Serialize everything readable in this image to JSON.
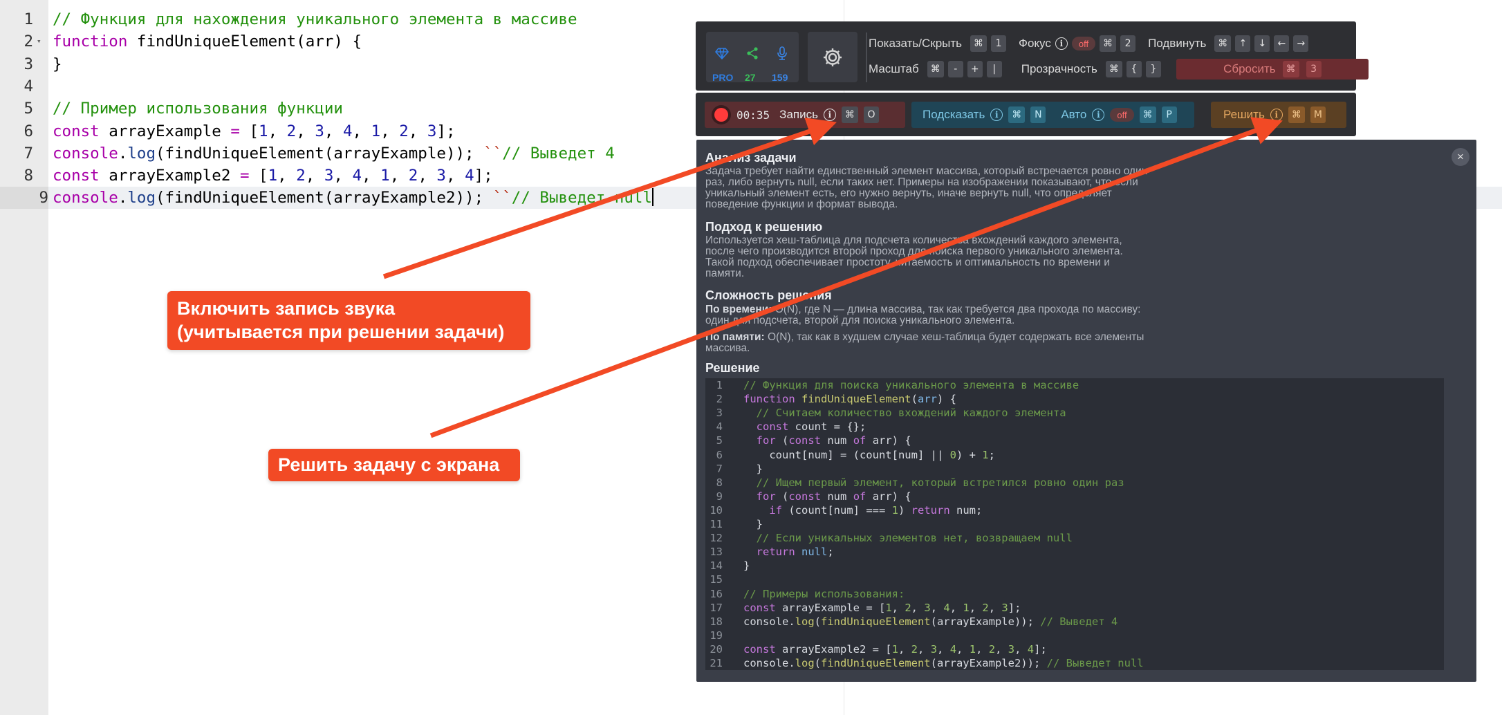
{
  "editor": {
    "lines": [
      {
        "n": "1",
        "tokens": [
          [
            "c",
            "// Функция для нахождения уникального элемента в массиве"
          ]
        ]
      },
      {
        "n": "2",
        "fold": true,
        "tokens": [
          [
            "k",
            "function"
          ],
          [
            "p",
            " findUniqueElement(arr) {"
          ]
        ]
      },
      {
        "n": "3",
        "tokens": [
          [
            "p",
            "}"
          ]
        ]
      },
      {
        "n": "4",
        "tokens": []
      },
      {
        "n": "5",
        "tokens": [
          [
            "c",
            "// Пример использования функции"
          ]
        ]
      },
      {
        "n": "6",
        "tokens": [
          [
            "k",
            "const"
          ],
          [
            "p",
            " arrayExample "
          ],
          [
            "k",
            "="
          ],
          [
            "p",
            " ["
          ],
          [
            "n",
            "1"
          ],
          [
            "p",
            ", "
          ],
          [
            "n",
            "2"
          ],
          [
            "p",
            ", "
          ],
          [
            "n",
            "3"
          ],
          [
            "p",
            ", "
          ],
          [
            "n",
            "4"
          ],
          [
            "p",
            ", "
          ],
          [
            "n",
            "1"
          ],
          [
            "p",
            ", "
          ],
          [
            "n",
            "2"
          ],
          [
            "p",
            ", "
          ],
          [
            "n",
            "3"
          ],
          [
            "p",
            "];"
          ]
        ]
      },
      {
        "n": "7",
        "tokens": [
          [
            "k",
            "console"
          ],
          [
            "p",
            "."
          ],
          [
            "f",
            "log"
          ],
          [
            "p",
            "(findUniqueElement(arrayExample)); "
          ],
          [
            "s",
            "``"
          ],
          [
            "c",
            "// Выведет 4"
          ]
        ]
      },
      {
        "n": "8",
        "tokens": [
          [
            "k",
            "const"
          ],
          [
            "p",
            " arrayExample2 "
          ],
          [
            "k",
            "="
          ],
          [
            "p",
            " ["
          ],
          [
            "n",
            "1"
          ],
          [
            "p",
            ", "
          ],
          [
            "n",
            "2"
          ],
          [
            "p",
            ", "
          ],
          [
            "n",
            "3"
          ],
          [
            "p",
            ", "
          ],
          [
            "n",
            "4"
          ],
          [
            "p",
            ", "
          ],
          [
            "n",
            "1"
          ],
          [
            "p",
            ", "
          ],
          [
            "n",
            "2"
          ],
          [
            "p",
            ", "
          ],
          [
            "n",
            "3"
          ],
          [
            "p",
            ", "
          ],
          [
            "n",
            "4"
          ],
          [
            "p",
            "];"
          ]
        ]
      },
      {
        "n": "9",
        "active": true,
        "tokens": [
          [
            "k",
            "console"
          ],
          [
            "p",
            "."
          ],
          [
            "f",
            "log"
          ],
          [
            "p",
            "(findUniqueElement(arrayExample2)); "
          ],
          [
            "s",
            "``"
          ],
          [
            "c",
            "// Выведет null"
          ]
        ]
      }
    ]
  },
  "toolbar": {
    "status": {
      "pro": "PRO",
      "shares": "27",
      "mic_count": "159"
    },
    "show_hide_label": "Показать/Скрыть",
    "show_hide_keys": [
      "⌘",
      "1"
    ],
    "focus_label": "Фокус",
    "focus_state": "off",
    "focus_keys": [
      "⌘",
      "2"
    ],
    "move_label": "Подвинуть",
    "move_keys": [
      "⌘",
      "↑",
      "↓",
      "←",
      "→"
    ],
    "scale_label": "Масштаб",
    "scale_keys": [
      "⌘",
      "-",
      "+",
      "|"
    ],
    "opacity_label": "Прозрачность",
    "opacity_keys": [
      "⌘",
      "{",
      "}"
    ],
    "reset_label": "Сбросить",
    "reset_keys": [
      "⌘",
      "3"
    ]
  },
  "actions": {
    "timer": "00:35",
    "record_label": "Запись",
    "record_keys": [
      "⌘",
      "O"
    ],
    "hint_label": "Подсказать",
    "hint_keys": [
      "⌘",
      "N"
    ],
    "auto_label": "Авто",
    "auto_state": "off",
    "auto_keys": [
      "⌘",
      "P"
    ],
    "solve_label": "Решить",
    "solve_keys": [
      "⌘",
      "M"
    ]
  },
  "solution": {
    "close": "×",
    "analysis_title": "Анализ задачи",
    "analysis_text": "Задача требует найти единственный элемент массива, который встречается ровно один раз, либо вернуть null, если таких нет. Примеры на изображении показывают, что если уникальный элемент есть, его нужно вернуть, иначе вернуть null, что определяет поведение функции и формат вывода.",
    "approach_title": "Подход к решению",
    "approach_text": "Используется хеш-таблица для подсчета количества вхождений каждого элемента, после чего производится второй проход для поиска первого уникального элемента. Такой подход обеспечивает простоту, читаемость и оптимальность по времени и памяти.",
    "complexity_title": "Сложность решения",
    "time_label": "По времени:",
    "time_text": " O(N), где N — длина массива, так как требуется два прохода по массиву: один для подсчета, второй для поиска уникального элемента.",
    "memory_label": "По памяти:",
    "memory_text": " O(N), так как в худшем случае хеш-таблица будет содержать все элементы массива.",
    "solution_title": "Решение",
    "code": [
      {
        "n": "1",
        "tokens": [
          [
            "c",
            "// Функция для поиска уникального элемента в массиве"
          ]
        ]
      },
      {
        "n": "2",
        "tokens": [
          [
            "k",
            "function"
          ],
          [
            "p",
            " "
          ],
          [
            "f",
            "findUniqueElement"
          ],
          [
            "p",
            "("
          ],
          [
            "b",
            "arr"
          ],
          [
            "p",
            ") {"
          ]
        ]
      },
      {
        "n": "3",
        "tokens": [
          [
            "p",
            "  "
          ],
          [
            "c",
            "// Считаем количество вхождений каждого элемента"
          ]
        ]
      },
      {
        "n": "4",
        "tokens": [
          [
            "p",
            "  "
          ],
          [
            "k",
            "const"
          ],
          [
            "p",
            " count = {};"
          ]
        ]
      },
      {
        "n": "5",
        "tokens": [
          [
            "p",
            "  "
          ],
          [
            "k",
            "for"
          ],
          [
            "p",
            " ("
          ],
          [
            "k",
            "const"
          ],
          [
            "p",
            " num "
          ],
          [
            "k",
            "of"
          ],
          [
            "p",
            " arr) {"
          ]
        ]
      },
      {
        "n": "6",
        "tokens": [
          [
            "p",
            "    count[num] = (count[num] || "
          ],
          [
            "n",
            "0"
          ],
          [
            "p",
            ") + "
          ],
          [
            "n",
            "1"
          ],
          [
            "p",
            ";"
          ]
        ]
      },
      {
        "n": "7",
        "tokens": [
          [
            "p",
            "  }"
          ]
        ]
      },
      {
        "n": "8",
        "tokens": [
          [
            "p",
            "  "
          ],
          [
            "c",
            "// Ищем первый элемент, который встретился ровно один раз"
          ]
        ]
      },
      {
        "n": "9",
        "tokens": [
          [
            "p",
            "  "
          ],
          [
            "k",
            "for"
          ],
          [
            "p",
            " ("
          ],
          [
            "k",
            "const"
          ],
          [
            "p",
            " num "
          ],
          [
            "k",
            "of"
          ],
          [
            "p",
            " arr) {"
          ]
        ]
      },
      {
        "n": "10",
        "tokens": [
          [
            "p",
            "    "
          ],
          [
            "k",
            "if"
          ],
          [
            "p",
            " (count[num] === "
          ],
          [
            "n",
            "1"
          ],
          [
            "p",
            ") "
          ],
          [
            "k",
            "return"
          ],
          [
            "p",
            " num;"
          ]
        ]
      },
      {
        "n": "11",
        "tokens": [
          [
            "p",
            "  }"
          ]
        ]
      },
      {
        "n": "12",
        "tokens": [
          [
            "p",
            "  "
          ],
          [
            "c",
            "// Если уникальных элементов нет, возвращаем null"
          ]
        ]
      },
      {
        "n": "13",
        "tokens": [
          [
            "p",
            "  "
          ],
          [
            "k",
            "return"
          ],
          [
            "p",
            " "
          ],
          [
            "b",
            "null"
          ],
          [
            "p",
            ";"
          ]
        ]
      },
      {
        "n": "14",
        "tokens": [
          [
            "p",
            "}"
          ]
        ]
      },
      {
        "n": "15",
        "tokens": []
      },
      {
        "n": "16",
        "tokens": [
          [
            "c",
            "// Примеры использования:"
          ]
        ]
      },
      {
        "n": "17",
        "tokens": [
          [
            "k",
            "const"
          ],
          [
            "p",
            " arrayExample = ["
          ],
          [
            "n",
            "1"
          ],
          [
            "p",
            ", "
          ],
          [
            "n",
            "2"
          ],
          [
            "p",
            ", "
          ],
          [
            "n",
            "3"
          ],
          [
            "p",
            ", "
          ],
          [
            "n",
            "4"
          ],
          [
            "p",
            ", "
          ],
          [
            "n",
            "1"
          ],
          [
            "p",
            ", "
          ],
          [
            "n",
            "2"
          ],
          [
            "p",
            ", "
          ],
          [
            "n",
            "3"
          ],
          [
            "p",
            "];"
          ]
        ]
      },
      {
        "n": "18",
        "tokens": [
          [
            "p",
            "console."
          ],
          [
            "f",
            "log"
          ],
          [
            "p",
            "("
          ],
          [
            "f",
            "findUniqueElement"
          ],
          [
            "p",
            "(arrayExample)); "
          ],
          [
            "c",
            "// Выведет 4"
          ]
        ]
      },
      {
        "n": "19",
        "tokens": []
      },
      {
        "n": "20",
        "tokens": [
          [
            "k",
            "const"
          ],
          [
            "p",
            " arrayExample2 = ["
          ],
          [
            "n",
            "1"
          ],
          [
            "p",
            ", "
          ],
          [
            "n",
            "2"
          ],
          [
            "p",
            ", "
          ],
          [
            "n",
            "3"
          ],
          [
            "p",
            ", "
          ],
          [
            "n",
            "4"
          ],
          [
            "p",
            ", "
          ],
          [
            "n",
            "1"
          ],
          [
            "p",
            ", "
          ],
          [
            "n",
            "2"
          ],
          [
            "p",
            ", "
          ],
          [
            "n",
            "3"
          ],
          [
            "p",
            ", "
          ],
          [
            "n",
            "4"
          ],
          [
            "p",
            "];"
          ]
        ]
      },
      {
        "n": "21",
        "tokens": [
          [
            "p",
            "console."
          ],
          [
            "f",
            "log"
          ],
          [
            "p",
            "("
          ],
          [
            "f",
            "findUniqueElement"
          ],
          [
            "p",
            "(arrayExample2)); "
          ],
          [
            "c",
            "// Выведет null"
          ]
        ]
      }
    ]
  },
  "callouts": {
    "record": "Включить запись звука\n(учитывается при решении задачи)",
    "solve": "Решить задачу с экрана"
  },
  "colors": {
    "accent": "#f24a25",
    "panel": "#2e2f33",
    "solution_bg": "#3a3e48"
  }
}
